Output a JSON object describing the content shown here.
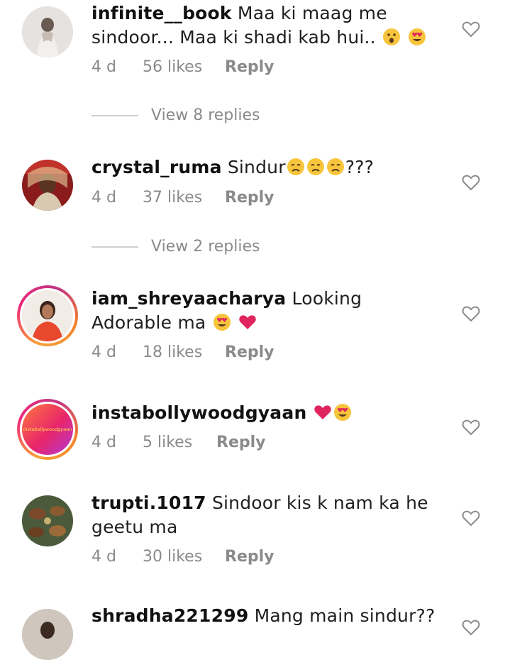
{
  "comments": [
    {
      "username": "infinite__book",
      "text": "Maa ki maag me sindoor... Maa ki shadi kab hui..",
      "emojis": [
        "astonished",
        "heart-eyes"
      ],
      "time": "4 d",
      "likes": "56 likes",
      "reply": "Reply",
      "view_replies": "View 8 replies"
    },
    {
      "username": "crystal_ruma",
      "text": "Sindur",
      "emojis": [
        "sad",
        "sad",
        "sad"
      ],
      "suffix": "???",
      "time": "4 d",
      "likes": "37 likes",
      "reply": "Reply",
      "view_replies": "View 2 replies"
    },
    {
      "username": "iam_shreyaacharya",
      "text": "Looking Adorable ma",
      "emojis": [
        "heart-eyes",
        "red-heart"
      ],
      "time": "4 d",
      "likes": "18 likes",
      "reply": "Reply"
    },
    {
      "username": "instabollywoodgyaan",
      "text": "",
      "emojis": [
        "red-heart",
        "heart-eyes"
      ],
      "avatar_text": "instabollywoodgyaan",
      "time": "4 d",
      "likes": "5 likes",
      "reply": "Reply"
    },
    {
      "username": "trupti.1017",
      "text": "Sindoor kis k nam ka he geetu ma",
      "time": "4 d",
      "likes": "30 likes",
      "reply": "Reply"
    },
    {
      "username": "shradha221299",
      "text": "Mang main sindur??"
    }
  ],
  "colors": {
    "meta": "#8a8a8a",
    "story_ring_start": "#f9a23a",
    "story_ring_end": "#c13584",
    "heart": "#e0245e",
    "emoji_face": "#f7c53b"
  }
}
